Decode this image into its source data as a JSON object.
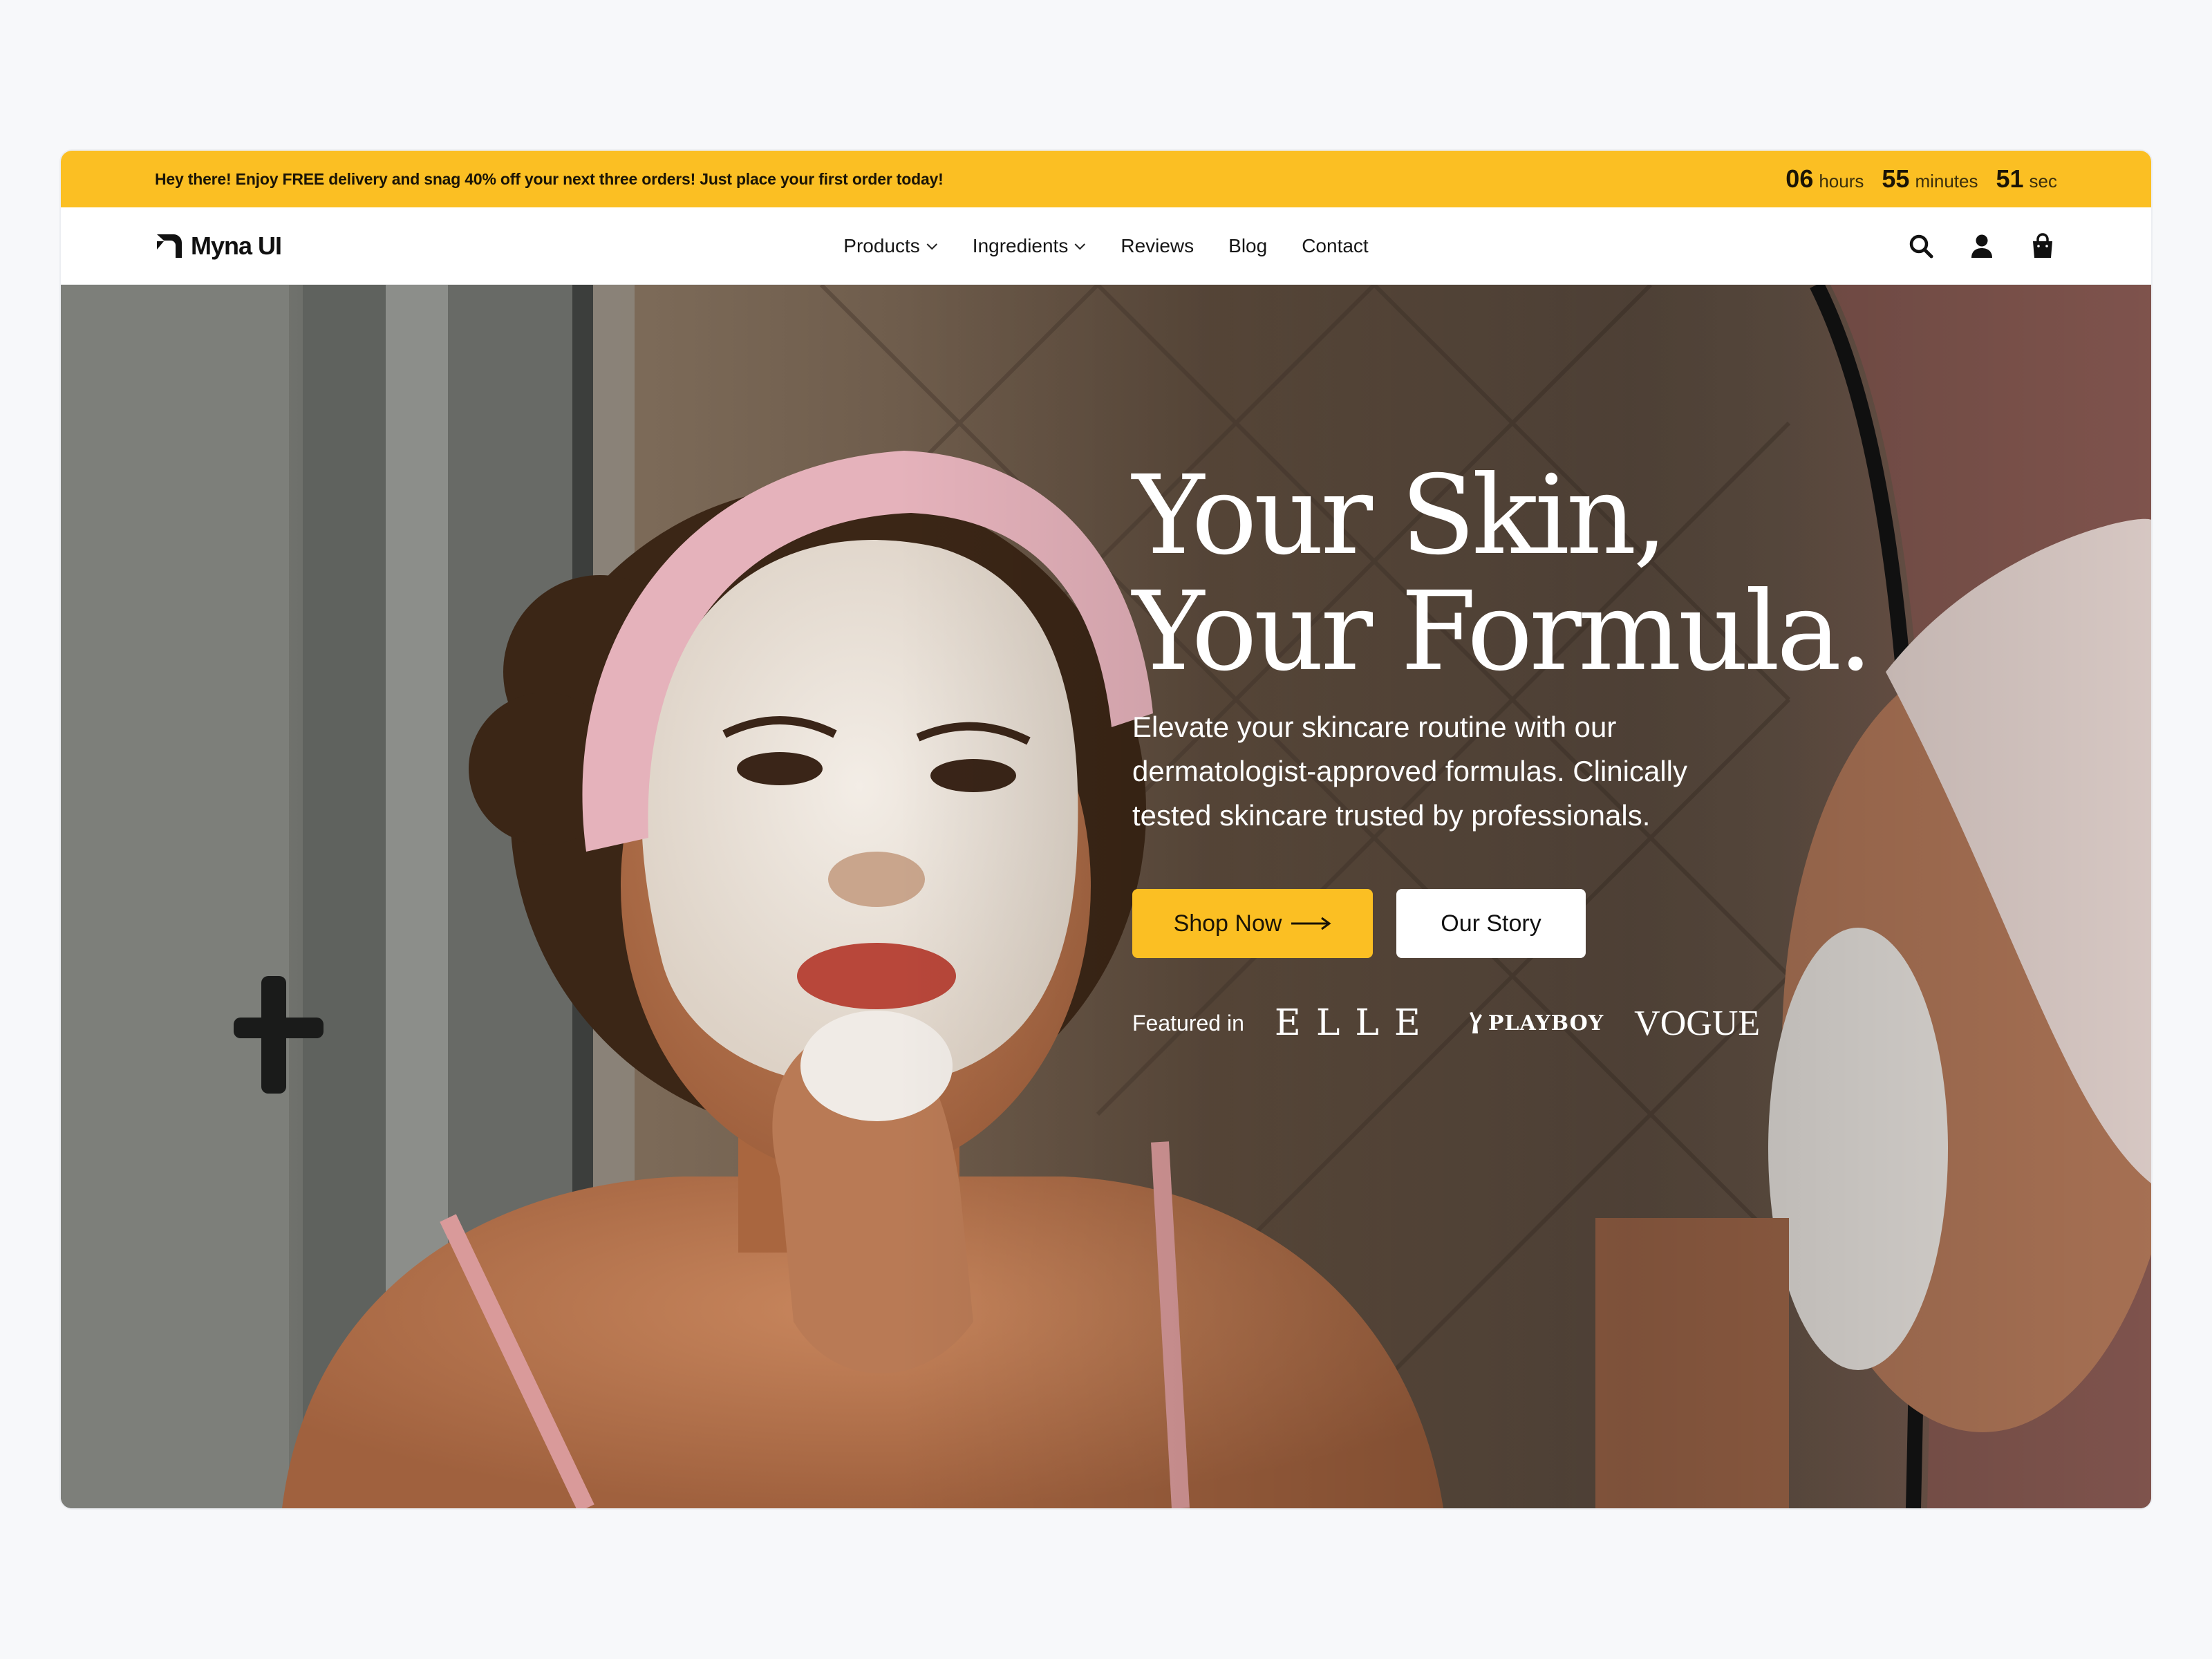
{
  "promo": {
    "message": "Hey there! Enjoy FREE delivery and snag 40% off your next three orders! Just place your first order today!",
    "countdown": [
      {
        "value": "06",
        "label": "hours"
      },
      {
        "value": "55",
        "label": "minutes"
      },
      {
        "value": "51",
        "label": "sec"
      }
    ]
  },
  "nav": {
    "logo_text": "Myna UI",
    "menu": [
      {
        "label": "Products",
        "has_dropdown": true
      },
      {
        "label": "Ingredients",
        "has_dropdown": true
      },
      {
        "label": "Reviews"
      },
      {
        "label": "Blog"
      },
      {
        "label": "Contact"
      }
    ],
    "icons": [
      "search-icon",
      "user-icon",
      "shopping-bag-icon"
    ]
  },
  "hero": {
    "headline_line1": "Your Skin,",
    "headline_line2": "Your Formula.",
    "subtext": "Elevate your skincare routine with our dermatologist-approved formulas. Clinically tested skincare trusted by professionals.",
    "primary_cta": "Shop Now",
    "secondary_cta": "Our Story",
    "featured_label": "Featured in",
    "press": [
      "ELLE",
      "PLAYBOY",
      "VOGUE"
    ]
  },
  "colors": {
    "accent": "#fbbf23",
    "page_bg": "#f7f8fa",
    "text_dark": "#111111"
  }
}
